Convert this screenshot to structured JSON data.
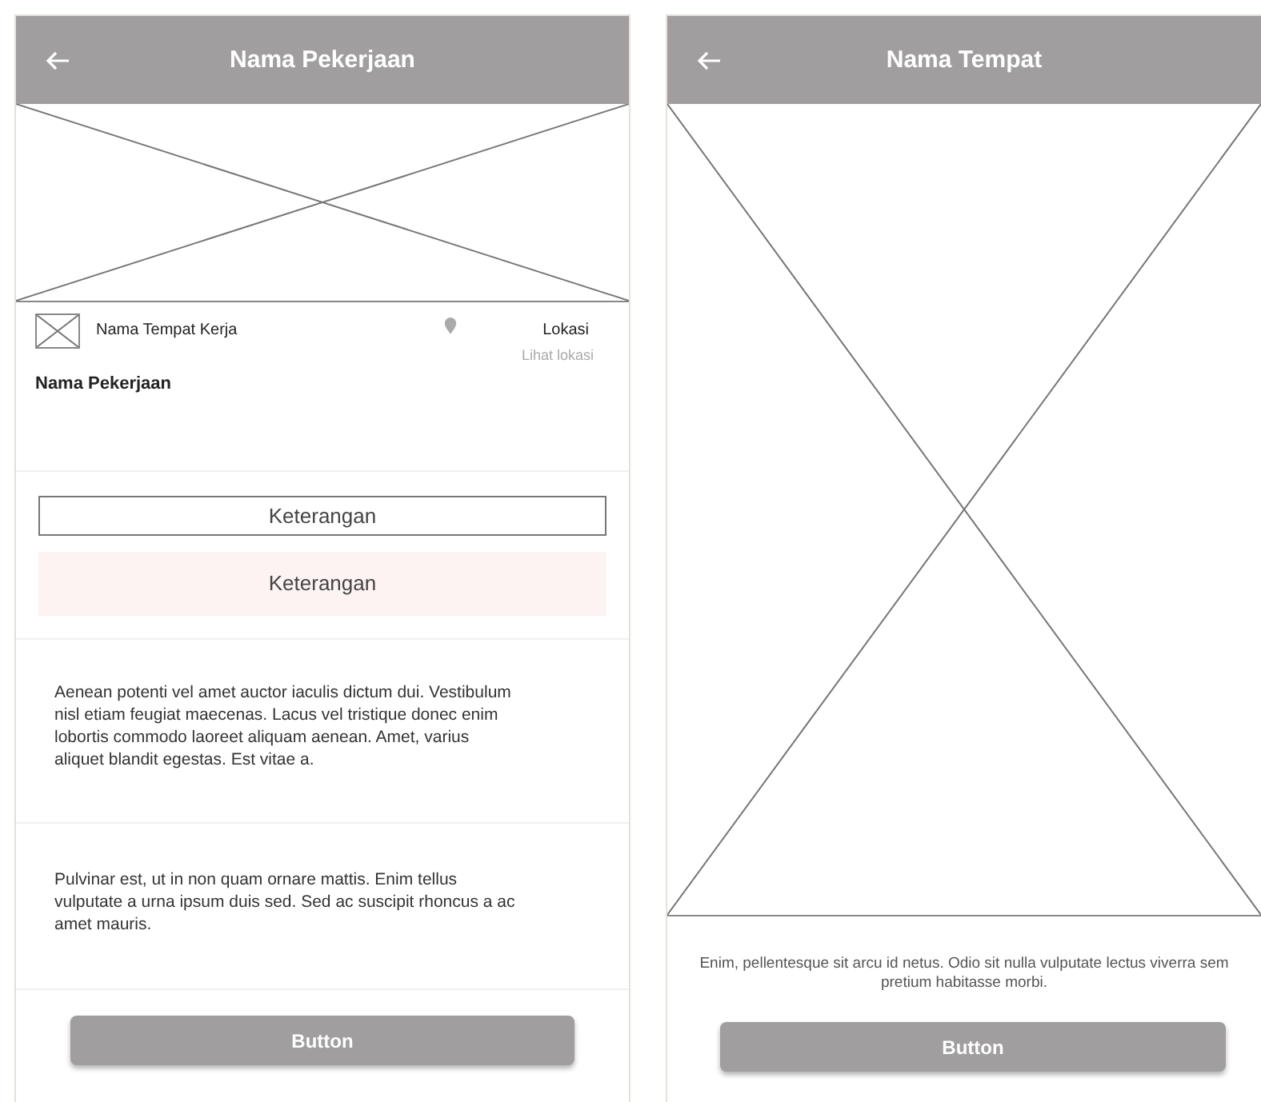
{
  "left_screen": {
    "title": "Nama Pekerjaan",
    "place_name": "Nama Tempat Kerja",
    "location_label": "Lokasi",
    "location_link": "Lihat lokasi",
    "job_title": "Nama Pekerjaan",
    "info_boxes": [
      {
        "kind": "outlined",
        "label": "Keterangan"
      },
      {
        "kind": "filled",
        "label": "Keterangan"
      }
    ],
    "paragraphs": [
      "Aenean potenti vel amet auctor iaculis dictum dui. Vestibulum nisl etiam feugiat maecenas. Lacus vel tristique donec enim lobortis commodo laoreet aliquam aenean. Amet, varius aliquet blandit egestas. Est vitae a.",
      "Pulvinar est, ut in non quam ornare mattis. Enim tellus vulputate a urna ipsum duis sed. Sed ac suscipit rhoncus a ac amet mauris."
    ],
    "button": "Button"
  },
  "right_screen": {
    "title": "Nama Tempat",
    "caption": "Enim, pellentesque sit arcu id netus. Odio sit nulla vulputate lectus viverra sem pretium habitasse morbi.",
    "button": "Button"
  }
}
